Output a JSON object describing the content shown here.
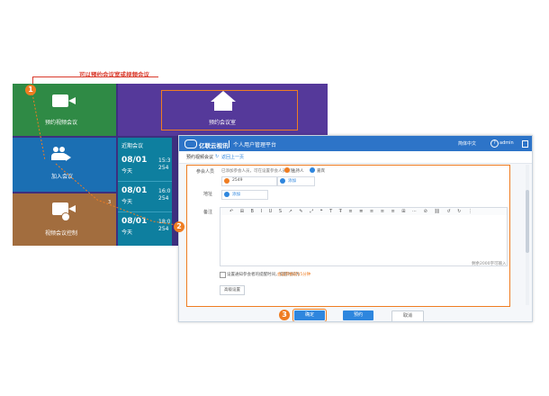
{
  "annotation": {
    "top_note": "可以预约会议室或视频会议",
    "step1": "1",
    "step2": "2",
    "step3": "3",
    "path_label": "3"
  },
  "tiles": {
    "book_video": "预约视频会议",
    "book_room": "预约会议室",
    "join": "加入会议",
    "video_control": "视频会议控制"
  },
  "recent": {
    "title": "近期会议",
    "items": [
      {
        "date": "08/01",
        "day": "今天",
        "time": "15:3",
        "num": "254"
      },
      {
        "date": "08/01",
        "day": "今天",
        "time": "16:0",
        "num": "254"
      },
      {
        "date": "08/01",
        "day": "今天",
        "time": "18:0",
        "num": "254"
      }
    ]
  },
  "dialog": {
    "logo": "亿联云视讯",
    "platform": "个人用户管理平台",
    "lang": "简体中文",
    "help_icon": "?",
    "user": "admin",
    "crumb_current": "预约视频会议",
    "crumb_back": "返回上一页",
    "participants_label": "参会人员",
    "participants_hint": "已添加参会人员，可在设置参会人员权限。",
    "role_host": "主持人",
    "role_guest": "嘉宾",
    "participant_chip": "2549",
    "add_label": "添加",
    "device_label": "地址",
    "device_add": "添加",
    "remark_label": "备注",
    "char_count": "剩余2000字可输入",
    "checkbox_text": "设置通知参会者的提醒时间，提醒时间为",
    "checkbox_link": "会议开始前15分钟",
    "more_settings": "高级设置",
    "confirm": "确定",
    "save_draft": "预约",
    "cancel": "取消"
  },
  "colors": {
    "green": "#2f8a45",
    "purple": "#55399a",
    "blue": "#1b6fb3",
    "brown": "#a26d3e",
    "teal": "#0e7f9f",
    "orange": "#ef7d22",
    "primary": "#2e86de"
  }
}
